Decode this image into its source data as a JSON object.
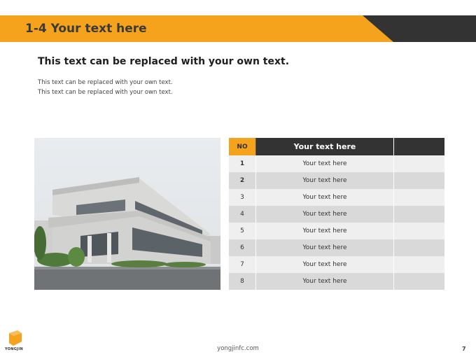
{
  "header": {
    "title": "1-4 Your text here"
  },
  "content": {
    "heading": "This text can be replaced with your own text.",
    "lines": [
      "This text can be replaced with your own text.",
      "This text can be replaced with your own text."
    ]
  },
  "table": {
    "headers": [
      "NO",
      "Your text here",
      ""
    ],
    "rows": [
      {
        "no": "1",
        "text": "Your text here"
      },
      {
        "no": "2",
        "text": "Your text here"
      },
      {
        "no": "3",
        "text": "Your text here"
      },
      {
        "no": "4",
        "text": "Your text here"
      },
      {
        "no": "5",
        "text": "Your text here"
      },
      {
        "no": "6",
        "text": "Your text here"
      },
      {
        "no": "7",
        "text": "Your text here"
      },
      {
        "no": "8",
        "text": "Your text here"
      }
    ]
  },
  "footer": {
    "logo_text": "YONGJIN",
    "url": "yongjinfc.com",
    "page": "7"
  },
  "colors": {
    "accent": "#f5a21c",
    "dark": "#333333"
  }
}
